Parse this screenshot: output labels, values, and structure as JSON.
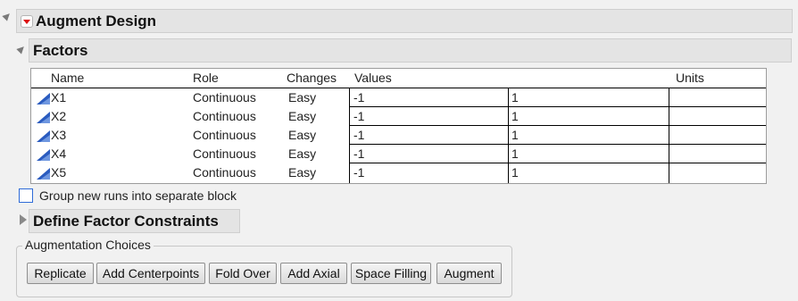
{
  "window": {
    "title": "Augment Design"
  },
  "factors": {
    "title": "Factors",
    "columns": {
      "name": "Name",
      "role": "Role",
      "changes": "Changes",
      "values": "Values",
      "units": "Units"
    },
    "rows": [
      {
        "name": "X1",
        "role": "Continuous",
        "changes": "Easy",
        "low": "-1",
        "high": "1",
        "units": ""
      },
      {
        "name": "X2",
        "role": "Continuous",
        "changes": "Easy",
        "low": "-1",
        "high": "1",
        "units": ""
      },
      {
        "name": "X3",
        "role": "Continuous",
        "changes": "Easy",
        "low": "-1",
        "high": "1",
        "units": ""
      },
      {
        "name": "X4",
        "role": "Continuous",
        "changes": "Easy",
        "low": "-1",
        "high": "1",
        "units": ""
      },
      {
        "name": "X5",
        "role": "Continuous",
        "changes": "Easy",
        "low": "-1",
        "high": "1",
        "units": ""
      }
    ]
  },
  "group_runs": {
    "label": "Group new runs into separate block",
    "checked": false
  },
  "constraints": {
    "title": "Define Factor Constraints"
  },
  "augmentation": {
    "label": "Augmentation Choices",
    "buttons": [
      "Replicate",
      "Add Centerpoints",
      "Fold Over",
      "Add Axial",
      "Space Filling",
      "Augment"
    ]
  },
  "colors": {
    "accent": "#2f6bd8",
    "menu_red": "#dd1111",
    "icon_blue": "#2a5bbf"
  }
}
